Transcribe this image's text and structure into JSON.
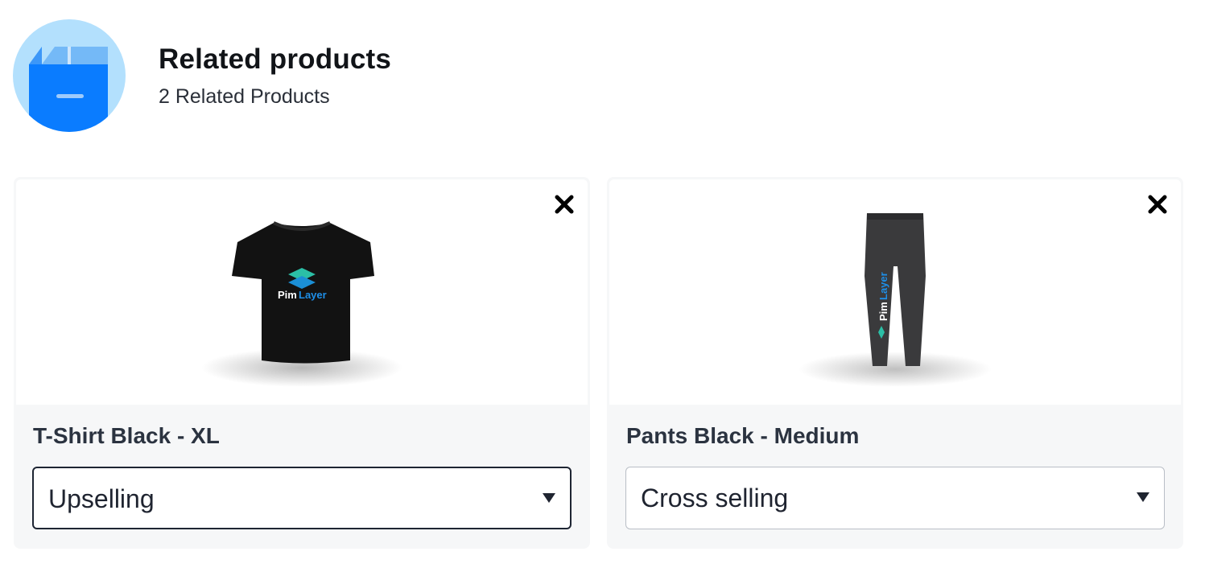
{
  "header": {
    "title": "Related products",
    "subtitle": "2 Related Products",
    "icon": "box-icon",
    "colors": {
      "avatar_bg": "#b3e0fd",
      "box": "#0a7cff"
    }
  },
  "products": [
    {
      "name": "T-Shirt Black - XL",
      "image": "tshirt-image",
      "relation": "Upselling",
      "remove_icon": "close-icon"
    },
    {
      "name": "Pants Black - Medium",
      "image": "pants-image",
      "relation": "Cross selling",
      "remove_icon": "close-icon"
    }
  ],
  "logo_text": {
    "pim": "Pim",
    "layer": "Layer"
  }
}
